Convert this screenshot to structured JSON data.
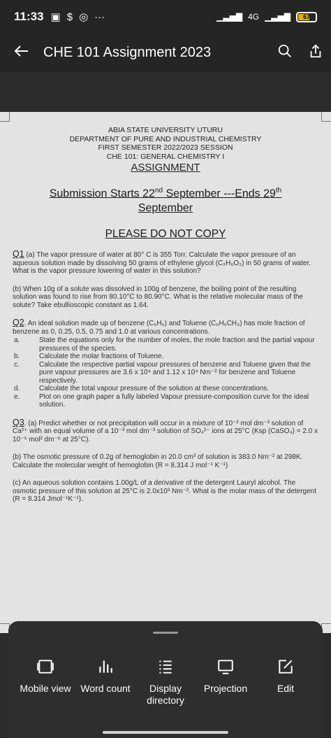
{
  "status_bar": {
    "time": "11:33",
    "network": "4G",
    "battery": "67"
  },
  "app_bar": {
    "title": "CHE 101 Assignment 2023"
  },
  "document": {
    "header": {
      "university": "ABIA STATE UNIVERSITY UTURU",
      "department": "DEPARTMENT OF PURE AND INDUSTRIAL CHEMISTRY",
      "session": "FIRST SEMESTER   2022/2023 SESSION",
      "course": "CHE 101: GENERAL CHEMISTRY I",
      "assignment": "ASSIGNMENT"
    },
    "submission": {
      "prefix": "Submission Starts 22",
      "sup1": "nd",
      "middle": " September ---Ends 29",
      "sup2": "th",
      "suffix": "September"
    },
    "notice": "PLEASE DO NOT COPY",
    "q1": {
      "number": "Q1",
      "a": " (a) The vapor pressure of water at 80° C is 355 Torr. Calculate the vapor pressure of an aqueous solution made by dissolving 50 grams of ethylene glycol (C₂H₆O₂) in 50 grams of water. What is the vapor pressure lowering of water in this solution?",
      "b": "(b) When 10g of a solute was dissolved in 100g of benzene, the boiling point of the resulting solution was found to rise from 80.10°C to 80.90°C. What is the relative molecular mass of the solute? Take ebullioscopic constant as 1.64."
    },
    "q2": {
      "number": "Q2",
      "intro": ". An ideal solution made up of benzene (C₆H₆) and Toluene (C₆H₅CH₃) has mole fraction of benzene as 0, 0.25, 0.5, 0.75 and 1.0 at various concentrations.",
      "items": [
        {
          "key": "a.",
          "text": "State the equations only for the number of moles, the mole fraction and the partial vapour pressures of the species."
        },
        {
          "key": "b.",
          "text": "Calculate the molar fractions of Toluene."
        },
        {
          "key": "c.",
          "text": "Calculate the respective partial vapour pressures of benzene and Toluene given that the pure vapour pressures are 3.6 x 10⁴ and 1.12 x 10⁴ Nm⁻² for benzene and Toluene respectively."
        },
        {
          "key": "d.",
          "text": "Calculate the total vapour pressure of the solution at these concentrations."
        },
        {
          "key": "e.",
          "text": "Plot on one graph paper a fully labeled Vapour pressure-composition curve for the ideal solution."
        }
      ]
    },
    "q3": {
      "number": "Q3",
      "a": ". (a) Predict whether or not precipitation will occur in a mixture of 10⁻² mol dm⁻³ solution of Ca²⁺ with an equal volume of a 10⁻³ mol dm⁻³ solution of SO₄²⁻ ions at 25°C (Ksp (CaSO₄) = 2.0 x 10⁻⁵ mol² dm⁻⁶ at 25°C).",
      "b": "(b) The osmotic pressure of 0.2g of hemoglobin in 20.0 cm³ of solution is 383.0 Nm⁻² at 298K. Calculate the molecular weight of hemoglobin (R = 8.314 J mol⁻¹ K⁻¹)",
      "c": "(c) An aqueous solution contains 1.00g/L of a derivative of the detergent Lauryl alcohol. The osmotic pressure of this solution at 25°C is 2.0x10³ Nm⁻². What is the molar mass of the detergent (R = 8.314 Jmol⁻¹K⁻¹)."
    }
  },
  "toolbar": {
    "items": [
      {
        "label": "Mobile view",
        "icon": "mobile-view-icon"
      },
      {
        "label": "Word count",
        "icon": "word-count-icon"
      },
      {
        "label": "Display directory",
        "icon": "list-icon"
      },
      {
        "label": "Projection",
        "icon": "monitor-icon"
      },
      {
        "label": "Edit",
        "icon": "edit-icon"
      }
    ]
  }
}
